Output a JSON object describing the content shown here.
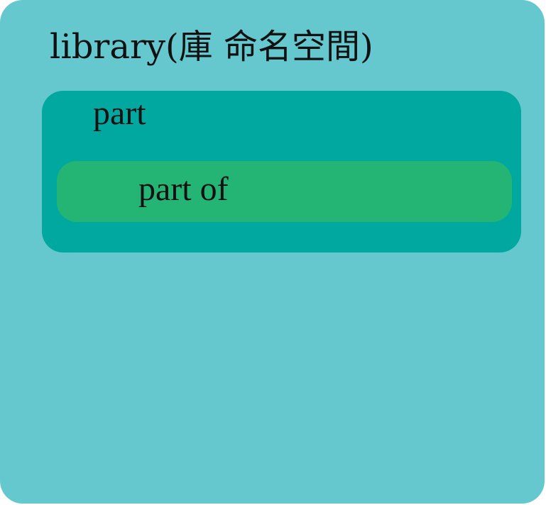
{
  "diagram": {
    "library": {
      "label": "library(庫 命名空間)",
      "color": "#66c8cf"
    },
    "part": {
      "label": "part",
      "color": "#00a8a0"
    },
    "part_of": {
      "label": "part of",
      "color": "#24b574"
    }
  }
}
